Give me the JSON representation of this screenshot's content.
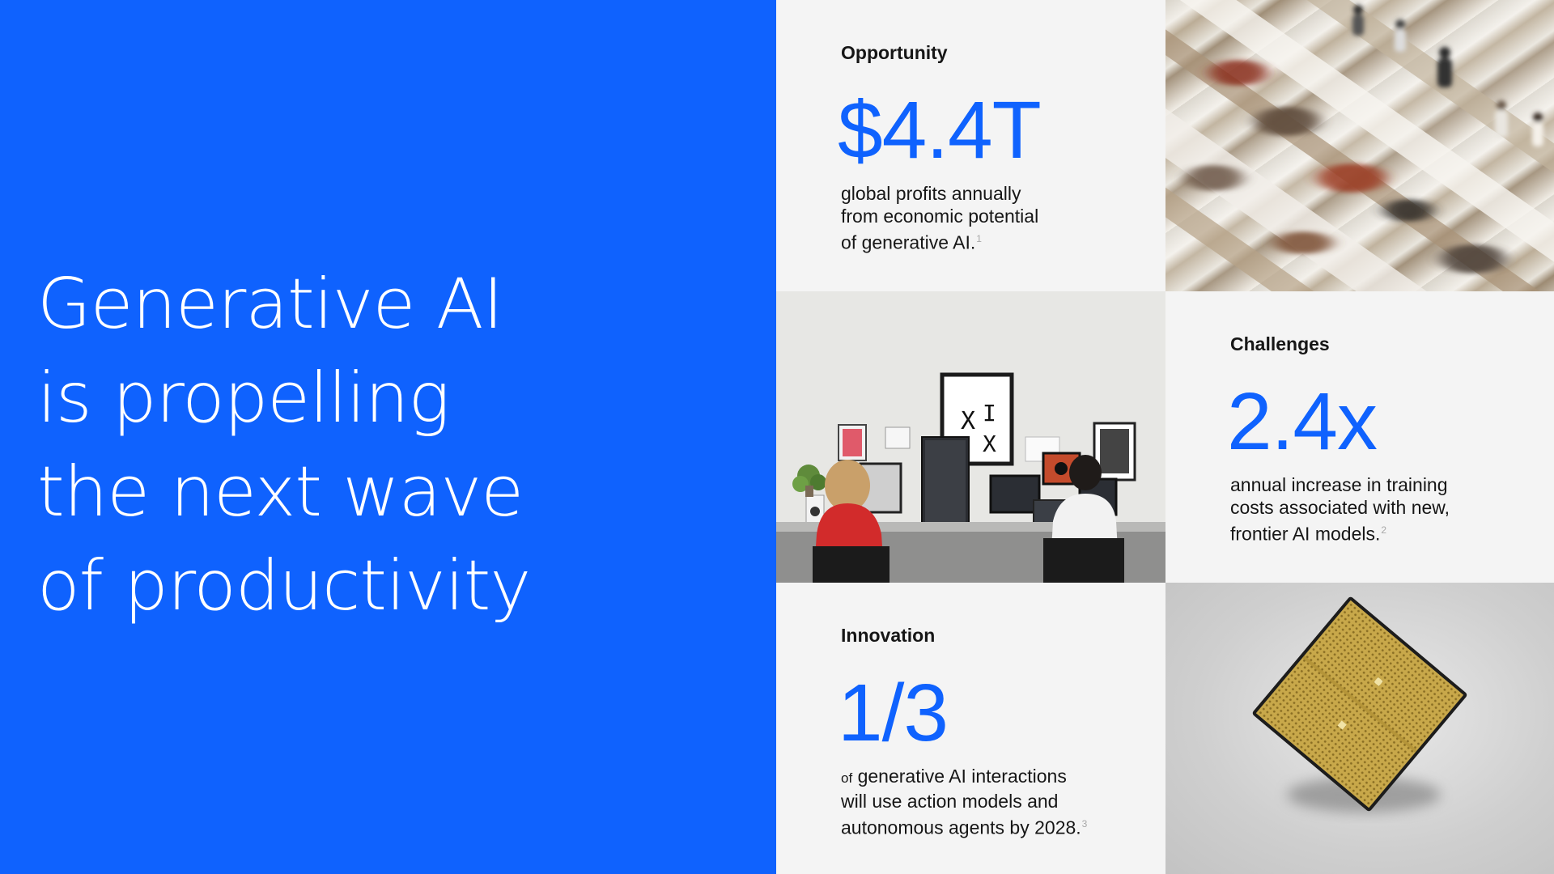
{
  "hero": {
    "lines": [
      "Generative AI",
      "is propelling",
      "the next wave",
      "of productivity"
    ]
  },
  "colors": {
    "brand_blue": "#0f62fe",
    "panel_bg": "#f4f4f4",
    "text_dark": "#161616",
    "footnote_gray": "#a8a8a8"
  },
  "opportunity": {
    "title": "Opportunity",
    "value": "$4.4T",
    "desc_lines": [
      "global profits annually",
      "from economic potential",
      "of generative AI."
    ],
    "footnote": "1"
  },
  "challenges": {
    "title": "Challenges",
    "value": "2.4x",
    "desc_lines": [
      "annual increase in training",
      "costs associated with new,",
      "frontier AI models."
    ],
    "footnote": "2"
  },
  "innovation": {
    "title": "Innovation",
    "value": "1/3",
    "desc_prefix": "of",
    "desc_lines": [
      " generative AI interactions",
      "will use action models and",
      "autonomous agents by 2028."
    ],
    "footnote": "3"
  },
  "images": {
    "escalator": "escalator-crowd-photo",
    "office": "office-workers-photo",
    "chip": "processor-chip-photo"
  }
}
